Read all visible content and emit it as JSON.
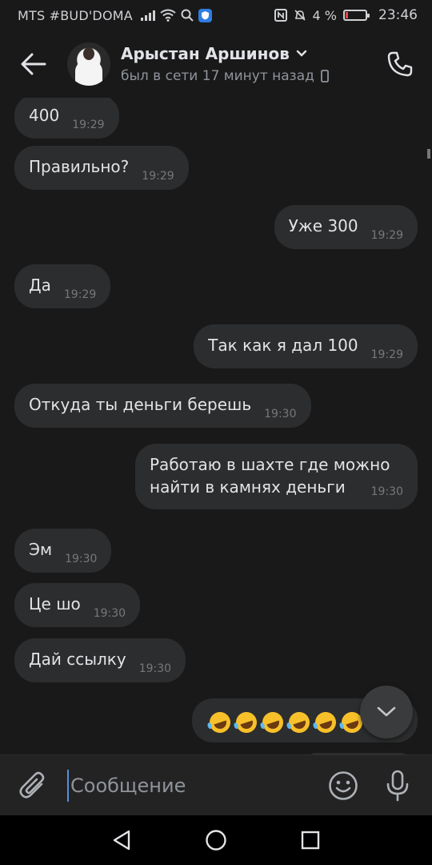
{
  "status_bar": {
    "carrier": "MTS #BUD'DOMA",
    "battery_percent": "4 %",
    "battery_level": 0.04,
    "time": "23:46",
    "icons": [
      "signal-icon",
      "wifi-icon",
      "search-icon",
      "shield-icon",
      "nfc-icon",
      "mute-icon",
      "battery-icon"
    ]
  },
  "header": {
    "contact_name": "Арыстан Аршинов",
    "presence": "был в сети 17 минут назад",
    "icons": [
      "back-arrow-icon",
      "chevron-down-icon",
      "mobile-device-icon",
      "phone-icon"
    ]
  },
  "messages": [
    {
      "direction": "in",
      "text": "400",
      "time": "19:29"
    },
    {
      "direction": "in",
      "text": "Правильно?",
      "time": "19:29"
    },
    {
      "direction": "out",
      "text": "Уже 300",
      "time": "19:29"
    },
    {
      "direction": "in",
      "text": "Да",
      "time": "19:29"
    },
    {
      "direction": "out",
      "text": "Так как я дал 100",
      "time": "19:29"
    },
    {
      "direction": "in",
      "text": "Откуда ты деньги берешь",
      "time": "19:30"
    },
    {
      "direction": "out",
      "text": "Работаю в шахте где можно найти в камнях деньги",
      "time": "19:30"
    },
    {
      "direction": "in",
      "text": "Эм",
      "time": "19:30"
    },
    {
      "direction": "in",
      "text": "Це шо",
      "time": "19:30"
    },
    {
      "direction": "in",
      "text": "Дай ссылку",
      "time": "19:30"
    },
    {
      "direction": "out",
      "text": "🤣🤣🤣🤣🤣🤣",
      "emoji_count": 6,
      "emoji": "rolling-on-the-floor-laughing"
    }
  ],
  "composer": {
    "placeholder": "Сообщение",
    "value": "",
    "icons": [
      "paperclip-icon",
      "smiley-icon",
      "microphone-icon"
    ]
  },
  "scroll_down_icon": "chevron-down-icon",
  "nav_bar": {
    "icons": [
      "back-triangle-icon",
      "home-circle-icon",
      "recents-square-icon"
    ]
  },
  "colors": {
    "background": "#19191a",
    "bubble": "#2c2d2e",
    "text": "#e1e3e6",
    "secondary_text": "#8f9399",
    "accent": "#5a8fd6"
  }
}
